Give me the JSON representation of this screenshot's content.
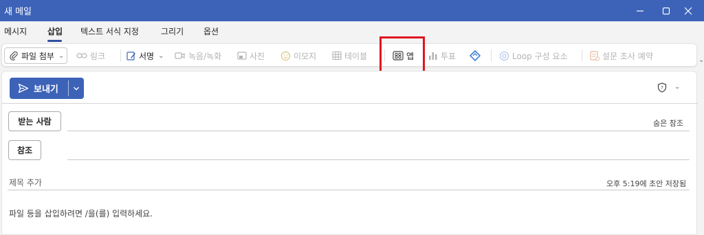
{
  "window": {
    "title": "새 메일",
    "controls": [
      "minimize-icon",
      "maximize-icon",
      "close-icon"
    ]
  },
  "menu": {
    "tabs": [
      "메시지",
      "삽입",
      "텍스트 서식 지정",
      "그리기",
      "옵션"
    ],
    "active": "삽입"
  },
  "ribbon": {
    "attach_file": "파일 첨부",
    "link": "링크",
    "signature": "서명",
    "record": "녹음/녹화",
    "photo": "사진",
    "emoji": "이모지",
    "table": "테이블",
    "apps": "앱",
    "poll": "투표",
    "loop": "Loop 구성 요소",
    "survey": "설문 조사 예약"
  },
  "compose": {
    "send_label": "보내기",
    "to_label": "받는 사람",
    "cc_label": "참조",
    "bcc_label": "숨은 참조",
    "subject_placeholder": "제목 추가",
    "saved_status": "오후 5:19에 초안 저장됨",
    "body_placeholder": "파일 등을 삽입하려면 /을(를) 입력하세요."
  },
  "colors": {
    "accent": "#3d63b8",
    "highlight": "#e0141e"
  }
}
